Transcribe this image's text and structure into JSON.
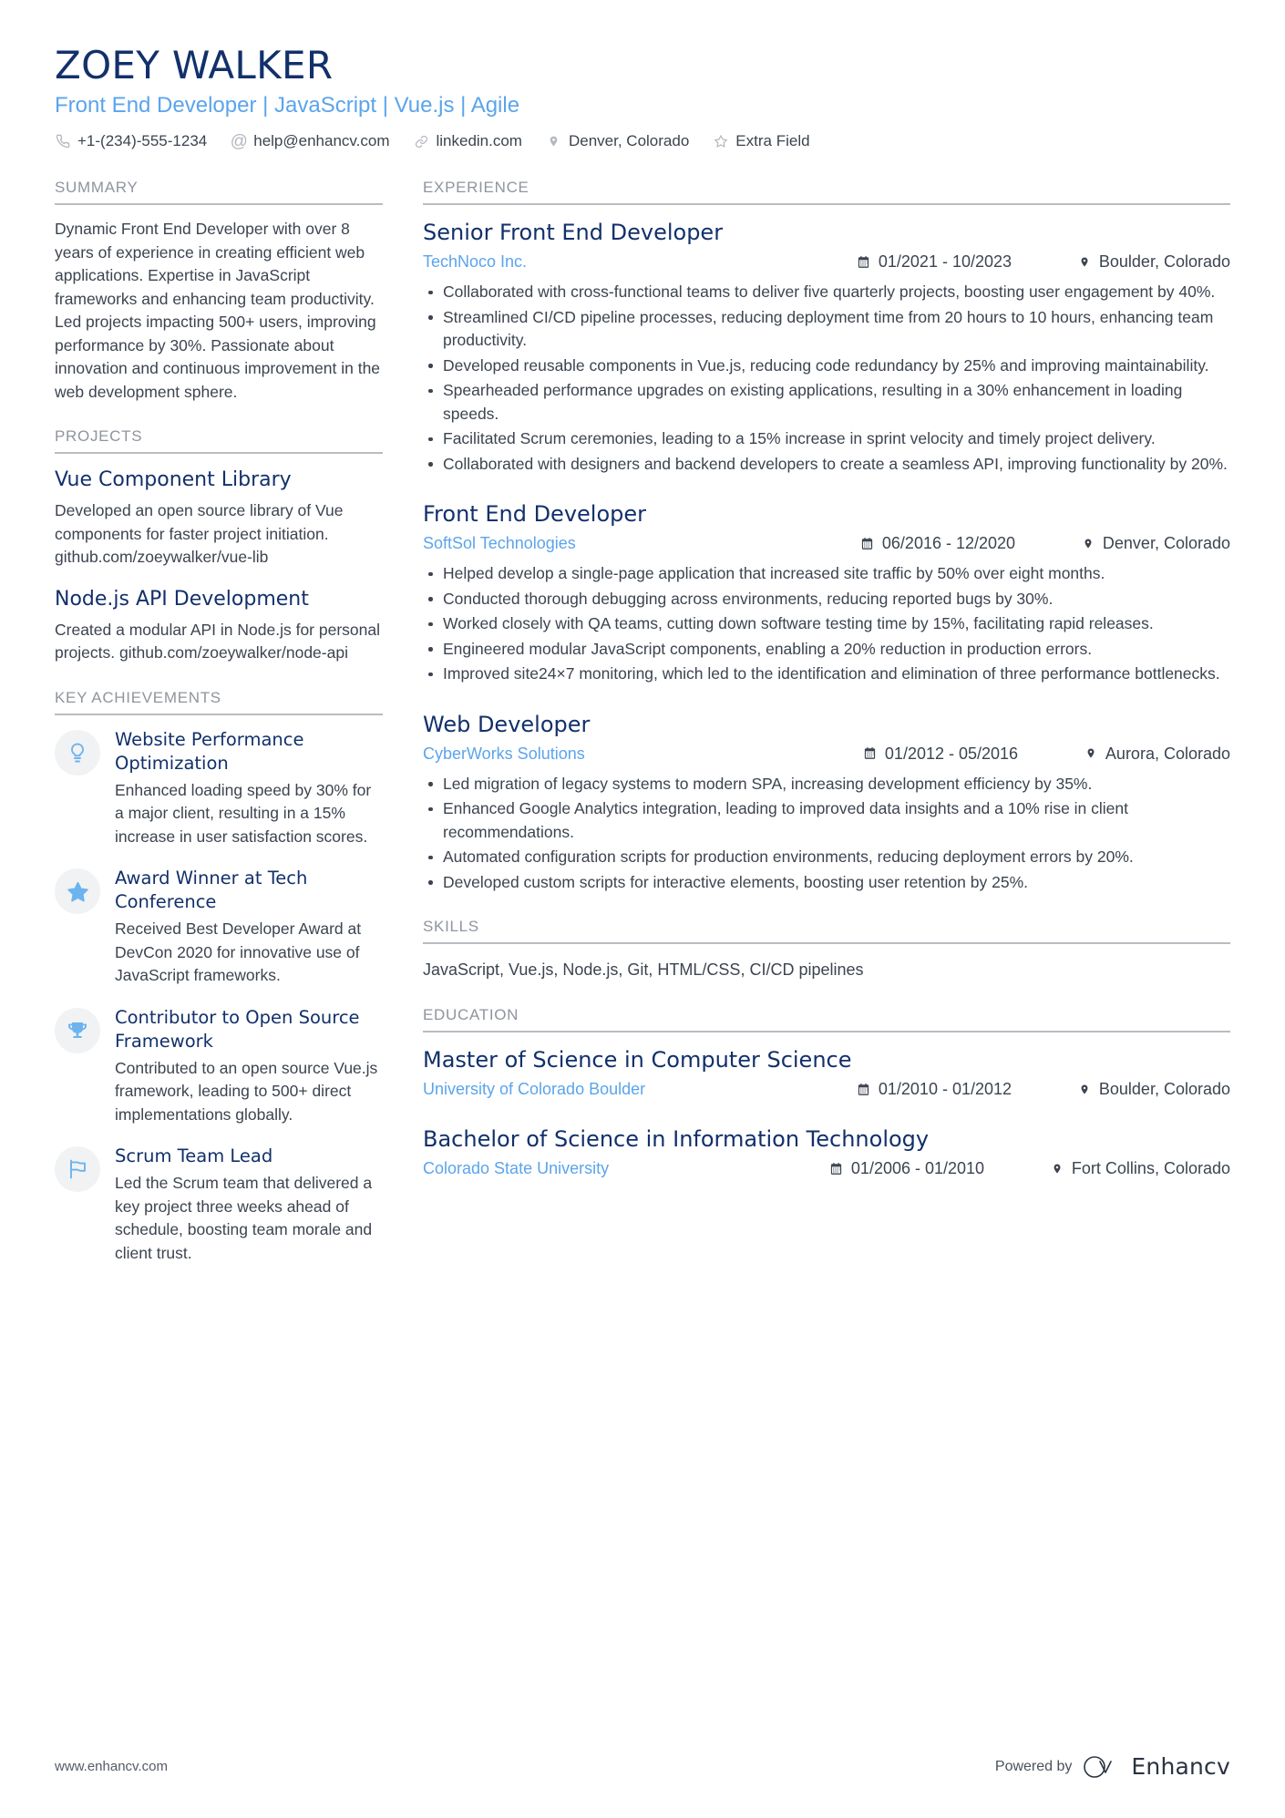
{
  "header": {
    "name": "ZOEY WALKER",
    "headline": "Front End Developer | JavaScript | Vue.js | Agile",
    "contacts": [
      {
        "icon": "phone-icon",
        "text": "+1-(234)-555-1234"
      },
      {
        "icon": "email-icon",
        "text": "help@enhancv.com"
      },
      {
        "icon": "link-icon",
        "text": "linkedin.com"
      },
      {
        "icon": "location-pin-icon",
        "text": "Denver, Colorado"
      },
      {
        "icon": "star-outline-icon",
        "text": "Extra Field"
      }
    ]
  },
  "summary": {
    "title": "SUMMARY",
    "text": "Dynamic Front End Developer with over 8 years of experience in creating efficient web applications. Expertise in JavaScript frameworks and enhancing team productivity. Led projects impacting 500+ users, improving performance by 30%. Passionate about innovation and continuous improvement in the web development sphere."
  },
  "projects": {
    "title": "PROJECTS",
    "items": [
      {
        "title": "Vue Component Library",
        "description": "Developed an open source library of Vue components for faster project initiation. github.com/zoeywalker/vue-lib"
      },
      {
        "title": "Node.js API Development",
        "description": "Created a modular API in Node.js for personal projects. github.com/zoeywalker/node-api"
      }
    ]
  },
  "achievements": {
    "title": "KEY ACHIEVEMENTS",
    "items": [
      {
        "icon": "lightbulb-icon",
        "title": "Website Performance Optimization",
        "description": "Enhanced loading speed by 30% for a major client, resulting in a 15% increase in user satisfaction scores."
      },
      {
        "icon": "star-icon",
        "title": "Award Winner at Tech Conference",
        "description": "Received Best Developer Award at DevCon 2020 for innovative use of JavaScript frameworks."
      },
      {
        "icon": "trophy-icon",
        "title": "Contributor to Open Source Framework",
        "description": "Contributed to an open source Vue.js framework, leading to 500+ direct implementations globally."
      },
      {
        "icon": "flag-icon",
        "title": "Scrum Team Lead",
        "description": "Led the Scrum team that delivered a key project three weeks ahead of schedule, boosting team morale and client trust."
      }
    ]
  },
  "experience": {
    "title": "EXPERIENCE",
    "items": [
      {
        "role": "Senior Front End Developer",
        "company": "TechNoco Inc.",
        "dates": "01/2021 - 10/2023",
        "location": "Boulder, Colorado",
        "bullets": [
          "Collaborated with cross-functional teams to deliver five quarterly projects, boosting user engagement by 40%.",
          "Streamlined CI/CD pipeline processes, reducing deployment time from 20 hours to 10 hours, enhancing team productivity.",
          "Developed reusable components in Vue.js, reducing code redundancy by 25% and improving maintainability.",
          "Spearheaded performance upgrades on existing applications, resulting in a 30% enhancement in loading speeds.",
          "Facilitated Scrum ceremonies, leading to a 15% increase in sprint velocity and timely project delivery.",
          "Collaborated with designers and backend developers to create a seamless API, improving functionality by 20%."
        ]
      },
      {
        "role": "Front End Developer",
        "company": "SoftSol Technologies",
        "dates": "06/2016 - 12/2020",
        "location": "Denver, Colorado",
        "bullets": [
          "Helped develop a single-page application that increased site traffic by 50% over eight months.",
          "Conducted thorough debugging across environments, reducing reported bugs by 30%.",
          "Worked closely with QA teams, cutting down software testing time by 15%, facilitating rapid releases.",
          "Engineered modular JavaScript components, enabling a 20% reduction in production errors.",
          "Improved site24×7 monitoring, which led to the identification and elimination of three performance bottlenecks."
        ]
      },
      {
        "role": "Web Developer",
        "company": "CyberWorks Solutions",
        "dates": "01/2012 - 05/2016",
        "location": "Aurora, Colorado",
        "bullets": [
          "Led migration of legacy systems to modern SPA, increasing development efficiency by 35%.",
          "Enhanced Google Analytics integration, leading to improved data insights and a 10% rise in client recommendations.",
          "Automated configuration scripts for production environments, reducing deployment errors by 20%.",
          "Developed custom scripts for interactive elements, boosting user retention by 25%."
        ]
      }
    ]
  },
  "skills": {
    "title": "SKILLS",
    "text": "JavaScript, Vue.js, Node.js, Git, HTML/CSS, CI/CD pipelines"
  },
  "education": {
    "title": "EDUCATION",
    "items": [
      {
        "degree": "Master of Science in Computer Science",
        "school": "University of Colorado Boulder",
        "dates": "01/2010 - 01/2012",
        "location": "Boulder, Colorado"
      },
      {
        "degree": "Bachelor of Science in Information Technology",
        "school": "Colorado State University",
        "dates": "01/2006 - 01/2010",
        "location": "Fort Collins, Colorado"
      }
    ]
  },
  "footer": {
    "website": "www.enhancv.com",
    "powered_by": "Powered by",
    "brand": "Enhancv"
  },
  "colors": {
    "name_navy": "#12306b",
    "accent_blue": "#5ba4ec",
    "body_text": "#3c4450",
    "muted": "#8f959e",
    "rule": "#b9bcc1",
    "badge_bg": "#f1f2f3",
    "icon_blue": "#6cb4f0"
  }
}
